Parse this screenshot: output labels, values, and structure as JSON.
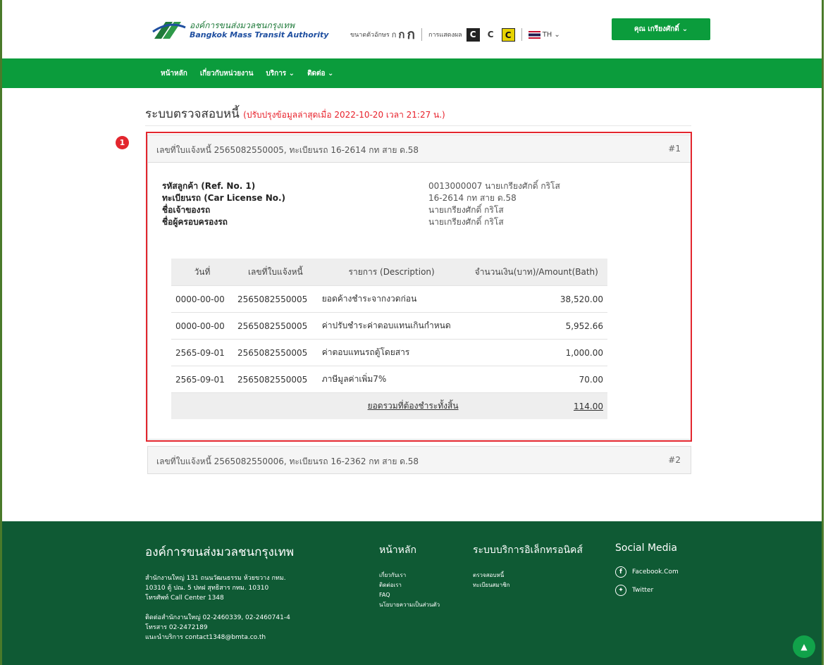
{
  "header": {
    "logo_th": "องค์การขนส่งมวลชนกรุงเทพ",
    "logo_en": "Bangkok Mass Transit Authority",
    "font_size_label": "ขนาดตัวอักษร",
    "font_size_a": "ก",
    "font_size_b": "ก",
    "font_size_c": "ก",
    "display_label": "การแสดงผล",
    "contrast_1": "C",
    "contrast_2": "C",
    "contrast_3": "C",
    "lang": "TH",
    "user_button": "คุณ เกรียงศักดิ์"
  },
  "nav": {
    "items": [
      "หน้าหลัก",
      "เกี่ยวกับหน่วยงาน",
      "บริการ",
      "ติดต่อ"
    ]
  },
  "page": {
    "title": "ระบบตรวจสอบหนี้",
    "note": "(ปรับปรุงข้อมูลล่าสุดเมื่อ 2022-10-20 เวลา 21:27 น.)"
  },
  "marker": "1",
  "invoices": [
    {
      "title": "เลขที่ใบแจ้งหนี้ 2565082550005, ทะเบียนรถ 16-2614 กท สาย ด.58",
      "num": "#1",
      "info": [
        {
          "label": "รหัสลูกค้า (Ref. No. 1)",
          "value": "0013000007 นายเกรียงศักดิ์ กริโส"
        },
        {
          "label": "ทะเบียนรถ (Car License No.)",
          "value": "16-2614 กท สาย ด.58"
        },
        {
          "label": "ชื่อเจ้าของรถ",
          "value": "นายเกรียงศักดิ์ กริโส"
        },
        {
          "label": "ชื่อผู้ครอบครองรถ",
          "value": "นายเกรียงศักดิ์ กริโส"
        }
      ],
      "table": {
        "headers": [
          "วันที่",
          "เลขที่ใบแจ้งหนี้",
          "รายการ (Description)",
          "จำนวนเงิน(บาท)/Amount(Bath)"
        ],
        "rows": [
          [
            "0000-00-00",
            "2565082550005",
            "ยอดค้างชำระจากงวดก่อน",
            "38,520.00"
          ],
          [
            "0000-00-00",
            "2565082550005",
            "ค่าปรับชำระค่าตอบแทนเกินกำหนด",
            "5,952.66"
          ],
          [
            "2565-09-01",
            "2565082550005",
            "ค่าตอบแทนรถตู้โดยสาร",
            "1,000.00"
          ],
          [
            "2565-09-01",
            "2565082550005",
            "ภาษีมูลค่าเพิ่ม7%",
            "70.00"
          ]
        ],
        "total_label": "ยอดรวมที่ต้องชำระทั้งสิ้น",
        "total_value": "114.00"
      }
    },
    {
      "title": "เลขที่ใบแจ้งหนี้ 2565082550006, ทะเบียนรถ 16-2362 กท สาย ด.58",
      "num": "#2"
    }
  ],
  "footer": {
    "org": "องค์การขนส่งมวลชนกรุงเทพ",
    "addr": [
      "สำนักงานใหญ่ 131 ถนนวัฒนธรรม ห้วยขวาง กทม.",
      "10310 ตู้ ปณ. 5 ปทฝ สุทธิสาร กทม. 10310",
      "โทรศัพท์ Call Center 1348",
      "",
      "ติดต่อสำนักงานใหญ่ 02-2460339, 02-2460741-4",
      "โทรสาร 02-2472189",
      "แนะนำบริการ contact1348@bmta.co.th"
    ],
    "col1_title": "หน้าหลัก",
    "col1_links": [
      "เกี่ยวกับเรา",
      "ติดต่อเรา",
      "FAQ",
      "นโยบายความเป็นส่วนตัว"
    ],
    "col2_title": "ระบบบริการอิเล็กทรอนิคส์",
    "col2_links": [
      "ตรวจสอบหนี้",
      "ทะเบียนสมาชิก"
    ],
    "col3_title": "Social Media",
    "facebook": "Facebook.Com",
    "twitter": "Twitter"
  },
  "colors": {
    "brand_green": "#0b9c3c",
    "footer_green": "#0f5a34",
    "highlight_red": "#e3262e"
  },
  "icons": [
    "bmta-logo-icon",
    "chevron-down-icon",
    "thai-flag-icon",
    "facebook-icon",
    "twitter-icon",
    "arrow-up-icon"
  ]
}
